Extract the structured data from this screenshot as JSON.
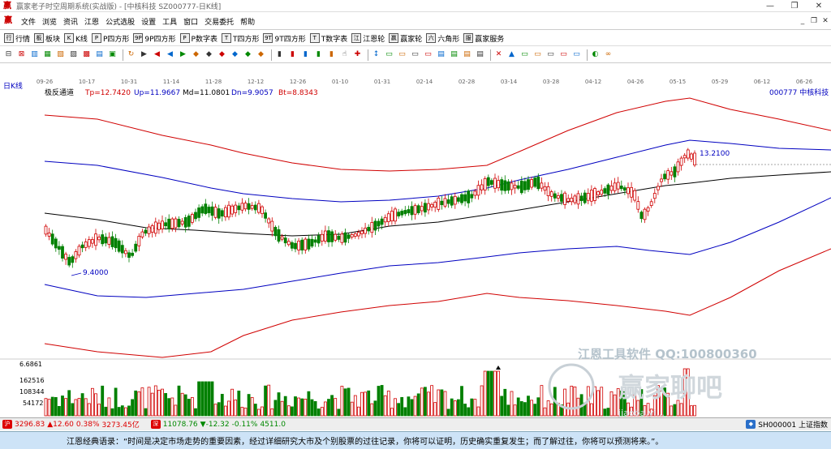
{
  "window": {
    "title": "赢家老子时空周期系统(实战版) - [中核科技 SZ000777-日K线]",
    "logo": "赢",
    "minimize": "—",
    "maximize": "❐",
    "close": "✕"
  },
  "menu": {
    "logo": "赢",
    "items": [
      "文件",
      "浏览",
      "资讯",
      "江恩",
      "公式选股",
      "设置",
      "工具",
      "窗口",
      "交易委托",
      "帮助"
    ],
    "right": [
      "_",
      "❐",
      "✕"
    ]
  },
  "toolbar1": [
    {
      "icon": "行",
      "label": "行情"
    },
    {
      "icon": "板",
      "label": "板块"
    },
    {
      "icon": "K",
      "label": "K线"
    },
    {
      "icon": "P",
      "label": "P四方形"
    },
    {
      "icon": "9P",
      "label": "9P四方形"
    },
    {
      "icon": "P",
      "label": "P数字表"
    },
    {
      "icon": "T",
      "label": "T四方形"
    },
    {
      "icon": "9T",
      "label": "9T四方形"
    },
    {
      "icon": "T",
      "label": "T数字表"
    },
    {
      "icon": "江",
      "label": "江恩轮"
    },
    {
      "icon": "赢",
      "label": "赢家轮"
    },
    {
      "icon": "六",
      "label": "六角形"
    },
    {
      "icon": "服",
      "label": "赢家服务"
    }
  ],
  "toolbar2_icons": [
    "⊟",
    "⊠",
    "▥",
    "▦",
    "▧",
    "▨",
    "▩",
    "▤",
    "▣",
    "↻",
    "▶",
    "◀",
    "◀",
    "▶",
    "◆",
    "◆",
    "◆",
    "◆",
    "◆",
    "◆",
    "▮",
    "▮",
    "▮",
    "▮",
    "▮",
    "☝",
    "✚",
    "↕",
    "▭",
    "▭",
    "▭",
    "▭",
    "▤",
    "▤",
    "▤",
    "▤",
    "✕",
    "▲",
    "▭",
    "▭",
    "▭",
    "▭",
    "▭",
    "◐",
    "∞"
  ],
  "chart_header": {
    "period": "日K线",
    "indicator": "极反通道",
    "tp": "Tp=12.7420",
    "up": "Up=11.9667",
    "md": "Md=11.0801",
    "dn": "Dn=9.9057",
    "bt": "Bt=8.8343",
    "code_name": "000777  中核科技"
  },
  "chart_data": {
    "type": "candlestick",
    "x_ticks": [
      "09-26",
      "10-17",
      "10-31",
      "11-14",
      "11-28",
      "12-12",
      "12-26",
      "01-10",
      "01-31",
      "02-14",
      "02-28",
      "03-14",
      "03-28",
      "04-12",
      "04-26",
      "05-15",
      "05-29",
      "06-12",
      "06-26"
    ],
    "high_label": "13.2100",
    "low_label": "9.4000",
    "volume_axis": [
      "6.6861",
      "162516",
      "108344",
      "54172"
    ],
    "colors": {
      "up": "#d00000",
      "down": "#008000",
      "tp_bt": "#d00000",
      "up_dn": "#0000c0",
      "md": "#000000"
    }
  },
  "watermark": {
    "line1": "江恩工具软件  QQ:100800360",
    "logo_text": "赢家聊吧",
    "url": "jiaoba.yi..."
  },
  "status": {
    "sh_index": "3296.83",
    "sh_change": "▲12.60",
    "sh_pct": "0.38%",
    "sh_amount": "3273.45亿",
    "sz_index": "11078.76",
    "sz_change": "▼-12.32",
    "sz_pct": "-0.11%",
    "sz_amount": "4511.0",
    "right_text": "SH000001 上证指数"
  },
  "bottom": {
    "quote": "江恩经典语录：“时间是决定市场走势的重要因素，经过详细研究大市及个别股票的过往记录，你将可以证明，历史确实重复发生；而了解过往，你将可以预测将来。”。"
  }
}
